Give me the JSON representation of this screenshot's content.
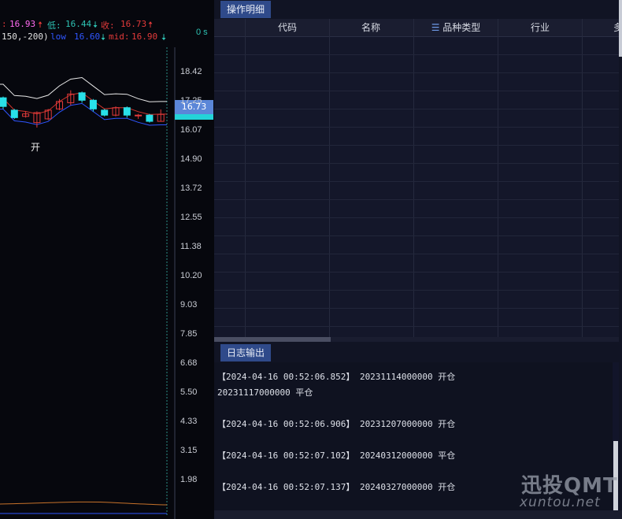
{
  "chart": {
    "header": {
      "high_sep": ":",
      "high_value": "16.93",
      "low_label": "低:",
      "low_value": "16.44",
      "close_label": "收:",
      "close_value": "16.73",
      "indicator_params": "150,-200)",
      "mid_label": "mid:",
      "mid_value": "16.90",
      "lower_partial": "low",
      "lower_value": "16.60"
    },
    "zero_s": "0 s",
    "current_price": "16.73",
    "open_marker": "开",
    "axis_ticks": [
      "18.42",
      "17.25",
      "16.07",
      "14.90",
      "13.72",
      "12.55",
      "11.38",
      "10.20",
      "9.03",
      "7.85",
      "6.68",
      "5.50",
      "4.33",
      "3.15",
      "1.98"
    ],
    "candles": [
      {
        "o": 17.4,
        "c": 17.05,
        "h": 17.45,
        "l": 16.95
      },
      {
        "o": 16.9,
        "c": 16.6,
        "h": 16.95,
        "l": 16.55
      },
      {
        "o": 16.65,
        "c": 16.75,
        "h": 16.85,
        "l": 16.6
      },
      {
        "o": 16.4,
        "c": 16.8,
        "h": 16.85,
        "l": 16.2
      },
      {
        "o": 16.55,
        "c": 16.9,
        "h": 16.95,
        "l": 16.5
      },
      {
        "o": 16.95,
        "c": 17.25,
        "h": 17.35,
        "l": 16.9
      },
      {
        "o": 17.2,
        "c": 17.55,
        "h": 17.7,
        "l": 17.1
      },
      {
        "o": 17.6,
        "c": 17.3,
        "h": 17.65,
        "l": 17.2
      },
      {
        "o": 17.3,
        "c": 16.95,
        "h": 17.35,
        "l": 16.85
      },
      {
        "o": 16.9,
        "c": 16.7,
        "h": 16.95,
        "l": 16.65
      },
      {
        "o": 16.7,
        "c": 17.0,
        "h": 17.05,
        "l": 16.65
      },
      {
        "o": 17.0,
        "c": 16.7,
        "h": 17.05,
        "l": 16.6
      },
      {
        "o": 16.68,
        "c": 16.7,
        "h": 16.75,
        "l": 16.55
      },
      {
        "o": 16.7,
        "c": 16.45,
        "h": 16.75,
        "l": 16.4
      },
      {
        "o": 16.45,
        "c": 16.73,
        "h": 16.93,
        "l": 16.44
      }
    ],
    "colors": {
      "up": "#e23a3a",
      "down": "#29e0e8",
      "upper": "#e8e8e8",
      "mid": "#d0342c",
      "lower": "#2f56ff",
      "high": "#e23a3a",
      "low": "#2ec3b4"
    }
  },
  "ops_panel": {
    "tab": "操作明细",
    "columns": [
      "",
      "代码",
      "名称",
      "品种类型",
      "行业",
      ""
    ],
    "sort_icon": "sort-icon",
    "rows": []
  },
  "log_panel": {
    "tab": "日志输出",
    "lines": [
      "【2024-04-16 00:52:06.852】 20231114000000 开仓",
      "20231117000000 平仓",
      "【2024-04-16 00:52:06.906】 20231207000000 开仓",
      "【2024-04-16 00:52:07.102】 20240312000000 平仓",
      "【2024-04-16 00:52:07.137】 20240327000000 开仓"
    ]
  },
  "watermark": {
    "main": "迅投QMT",
    "sub": "xuntou.net"
  }
}
